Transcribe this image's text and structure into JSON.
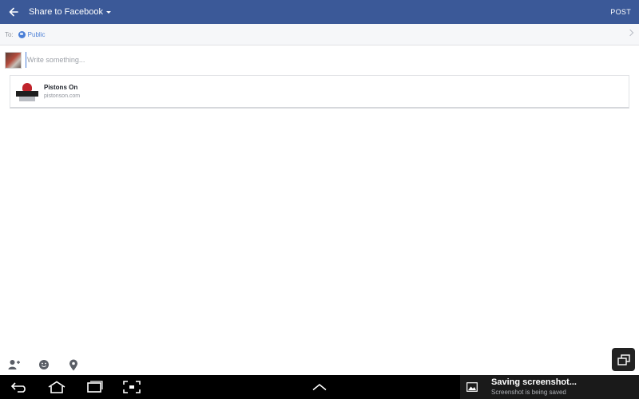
{
  "header": {
    "title": "Share to Facebook",
    "post_label": "POST"
  },
  "to_row": {
    "label": "To:",
    "audience": "Public"
  },
  "composer": {
    "placeholder": "Write something..."
  },
  "link_preview": {
    "title": "Pistons On",
    "domain": "pistonson.com"
  },
  "tools": [
    "tag-people-icon",
    "emoji-icon",
    "location-icon"
  ],
  "notification": {
    "title": "Saving screenshot...",
    "subtitle": "Screenshot is being saved"
  },
  "colors": {
    "header_bg": "#3b5998",
    "link_blue": "#4b7fd6",
    "nav_bg": "#000000"
  }
}
